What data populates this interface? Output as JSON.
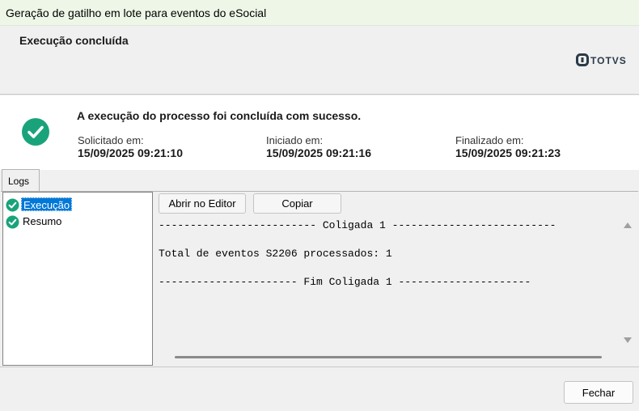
{
  "window": {
    "title": "Geração de gatilho em lote para eventos do eSocial"
  },
  "header": {
    "title": "Execução concluída",
    "logo_text": "TOTVS"
  },
  "summary": {
    "message": "A execução do processo foi concluída com sucesso.",
    "requested_label": "Solicitado em:",
    "requested_value": "15/09/2025 09:21:10",
    "started_label": "Iniciado em:",
    "started_value": "15/09/2025 09:21:16",
    "finished_label": "Finalizado em:",
    "finished_value": "15/09/2025 09:21:23",
    "success_color": "#1aa37a"
  },
  "tabs": [
    {
      "label": "Logs"
    }
  ],
  "tree": {
    "items": [
      {
        "label": "Execução",
        "icon": "check-circle-icon",
        "selected": true
      },
      {
        "label": "Resumo",
        "icon": "check-circle-icon",
        "selected": false
      }
    ]
  },
  "toolbar": {
    "open_editor_label": "Abrir no Editor",
    "copy_label": "Copiar"
  },
  "log": {
    "lines": [
      "------------------------- Coligada 1 --------------------------",
      "Total de eventos S2206 processados: 1",
      "---------------------- Fim Coligada 1 ---------------------"
    ]
  },
  "footer": {
    "close_label": "Fechar"
  }
}
